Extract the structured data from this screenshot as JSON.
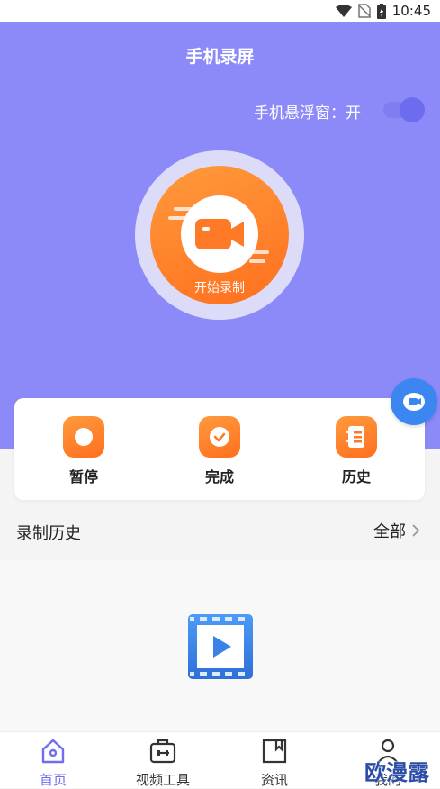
{
  "status_bar": {
    "time": "10:45"
  },
  "header": {
    "title": "手机录屏"
  },
  "float_window": {
    "label": "手机悬浮窗：开",
    "enabled": true
  },
  "record": {
    "label": "开始录制"
  },
  "actions": [
    {
      "label": "暂停",
      "icon": "pause-icon"
    },
    {
      "label": "完成",
      "icon": "check-icon"
    },
    {
      "label": "历史",
      "icon": "history-icon"
    }
  ],
  "history": {
    "title": "录制历史",
    "all_label": "全部"
  },
  "tabs": [
    {
      "label": "首页",
      "icon": "home-icon",
      "active": true
    },
    {
      "label": "视频工具",
      "icon": "toolbox-icon",
      "active": false
    },
    {
      "label": "资讯",
      "icon": "bookmark-icon",
      "active": false
    },
    {
      "label": "我的",
      "icon": "user-icon",
      "active": false
    }
  ],
  "watermark": "欧漫露",
  "colors": {
    "hero": "#8b8af8",
    "accent": "#ff7a26",
    "fab": "#3c86f2",
    "active_tab": "#6f6ef0"
  }
}
